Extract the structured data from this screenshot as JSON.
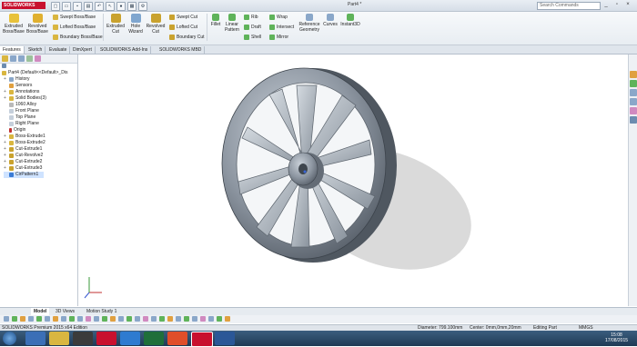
{
  "app": {
    "logo": "SOLIDWORKS",
    "document_title": "Part4 *"
  },
  "search": {
    "placeholder": "Search Commands"
  },
  "ribbon": {
    "extruded_boss": "Extruded Boss/Base",
    "revolved_boss": "Revolved Boss/Base",
    "swept_boss": "Swept Boss/Base",
    "lofted_boss": "Lofted Boss/Base",
    "boundary_boss": "Boundary Boss/Base",
    "extruded_cut": "Extruded Cut",
    "hole_wizard": "Hole Wizard",
    "revolved_cut": "Revolved Cut",
    "swept_cut": "Swept Cut",
    "lofted_cut": "Lofted Cut",
    "boundary_cut": "Boundary Cut",
    "fillet": "Fillet",
    "linear_pattern": "Linear Pattern",
    "rib": "Rib",
    "draft": "Draft",
    "shell": "Shell",
    "wrap": "Wrap",
    "intersect": "Intersect",
    "mirror": "Mirror",
    "reference_geometry": "Reference Geometry",
    "curves": "Curves",
    "instant3d": "Instant3D"
  },
  "tabs": [
    "Features",
    "Sketch",
    "Evaluate",
    "DimXpert",
    "SOLIDWORKS Add-Ins",
    "SOLIDWORKS MBD"
  ],
  "tree": {
    "root": "Part4 (Default<<Default>_Dis",
    "items": [
      "History",
      "Sensors",
      "Annotations",
      "Solid Bodies(3)",
      "1060 Alloy",
      "Front Plane",
      "Top Plane",
      "Right Plane",
      "Origin",
      "Boss-Extrude1",
      "Boss-Extrude2",
      "Cut-Extrude1",
      "Cut-Revolve2",
      "Cut-Extrude2",
      "Cut-Extrude3",
      "CirPattern1"
    ]
  },
  "bottom_tabs": [
    "Model",
    "3D Views",
    "Motion Study 1"
  ],
  "status": {
    "edition": "SOLIDWORKS Premium 2015 x64 Edition",
    "diameter": "Diameter: 799.100mm",
    "center": "Center: 0mm,0mm,20mm",
    "mode": "Editing Part",
    "units": "MMGS"
  },
  "clock": {
    "time": "15:08",
    "date": "17/08/2015"
  },
  "colors": {
    "accent": "#c8102e",
    "taskbar": "#2a4a6a",
    "selection": "#cfe3ff"
  }
}
